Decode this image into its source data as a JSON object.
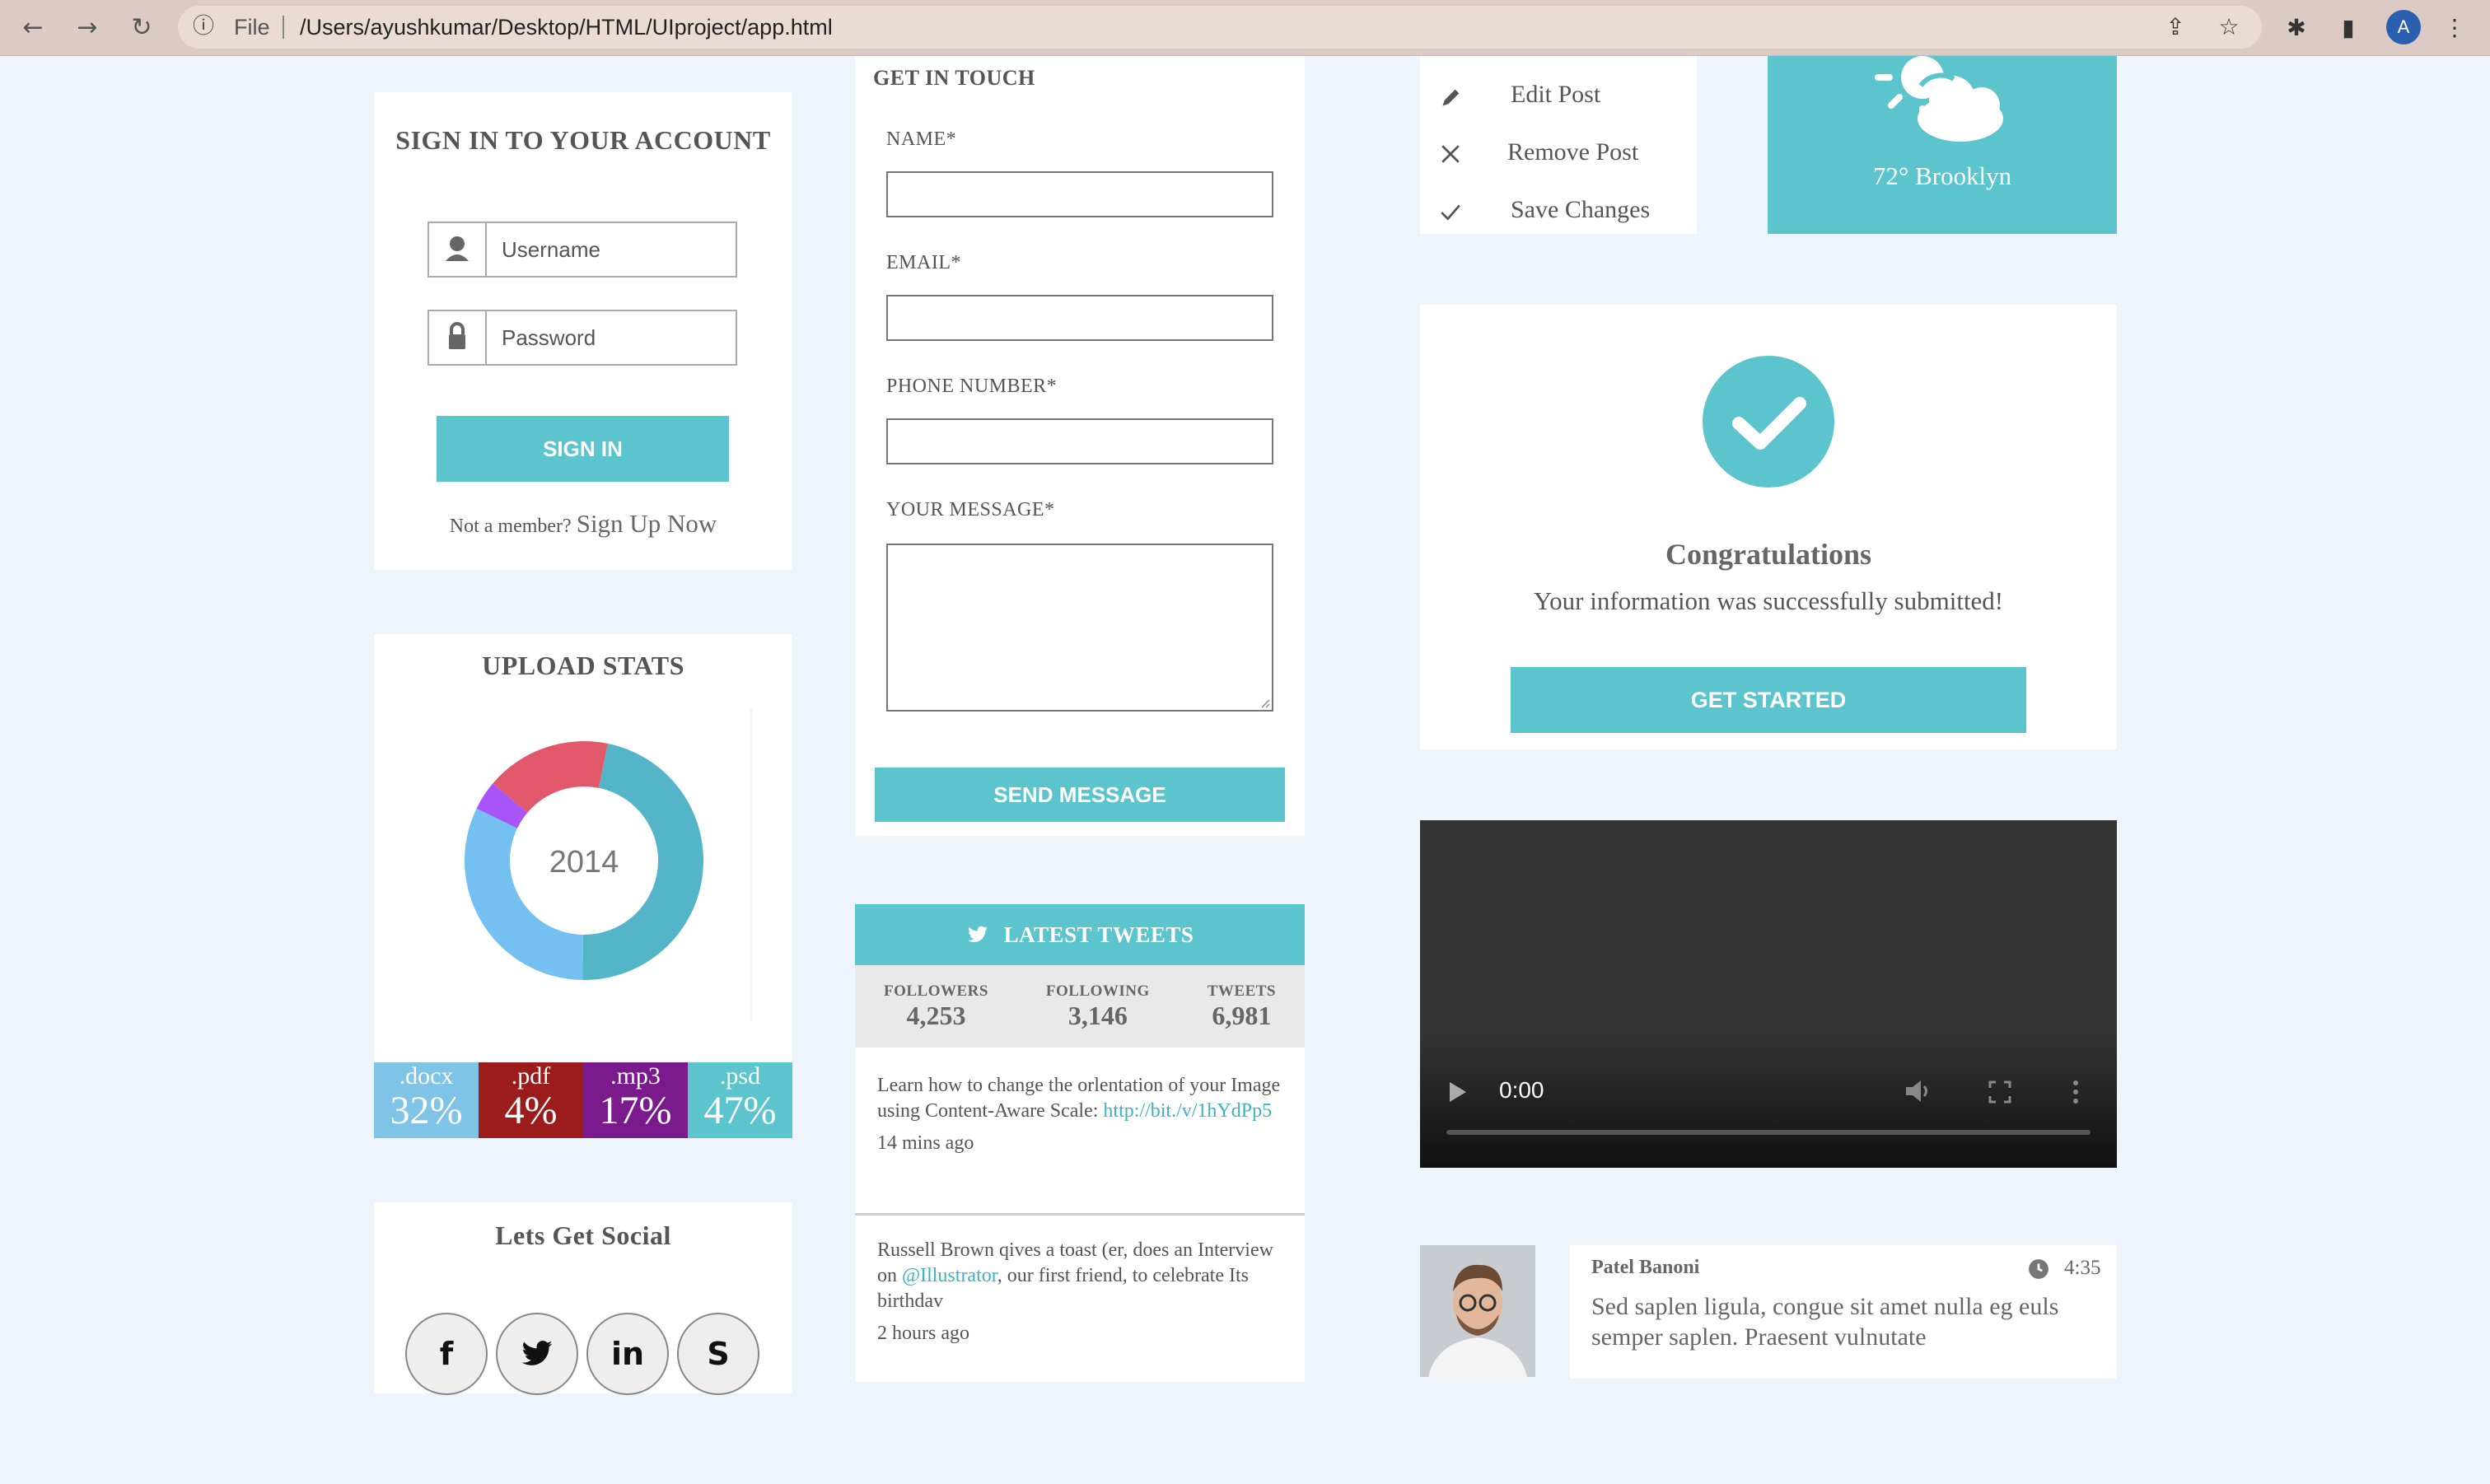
{
  "browser": {
    "scheme": "File",
    "url": "/Users/ayushkumar/Desktop/HTML/UIproject/app.html",
    "profile_initial": "A"
  },
  "colors": {
    "accent": "#5bc4cc",
    "page_bg": "#eef4fb"
  },
  "signin": {
    "title": "SIGN IN TO YOUR ACCOUNT",
    "username_placeholder": "Username",
    "password_placeholder": "Password",
    "button": "SIGN IN",
    "not_member": "Not a member?",
    "signup_link": "Sign Up Now"
  },
  "upload_stats": {
    "title": "UPLOAD STATS",
    "center_label": "2014",
    "items": [
      {
        "ext": ".docx",
        "pct": "32%",
        "value": 32,
        "bar_color": "#7fc3e6",
        "ring_color": "#74c0f0"
      },
      {
        "ext": ".pdf",
        "pct": "4%",
        "value": 4,
        "bar_color": "#9c1c1c",
        "ring_color": "#a855f7"
      },
      {
        "ext": ".mp3",
        "pct": "17%",
        "value": 17,
        "bar_color": "#7b1a8c",
        "ring_color": "#e0586a"
      },
      {
        "ext": ".psd",
        "pct": "47%",
        "value": 47,
        "bar_color": "#5bc4cc",
        "ring_color": "#55b5c8"
      }
    ]
  },
  "social": {
    "title": "Lets Get Social",
    "icons": [
      "facebook-icon",
      "twitter-icon",
      "linkedin-icon",
      "skype-icon"
    ],
    "glyphs": [
      "f",
      "🐦",
      "in",
      "S"
    ]
  },
  "contact": {
    "title": "GET IN TOUCH",
    "name_label": "NAME*",
    "email_label": "EMAIL*",
    "phone_label": "PHONE NUMBER*",
    "message_label": "YOUR MESSAGE*",
    "button": "SEND MESSAGE"
  },
  "tweets": {
    "header": "LATEST TWEETS",
    "stats": [
      {
        "label": "FOLLOWERS",
        "value": "4,253"
      },
      {
        "label": "FOLLOWING",
        "value": "3,146"
      },
      {
        "label": "TWEETS",
        "value": "6,981"
      }
    ],
    "items": [
      {
        "text": "Learn how to change the orlentation of your Image using Content-Aware Scale:",
        "link": "http://bit./v/1hYdPp5",
        "time": "14 mins ago"
      },
      {
        "text_before": "Russell Brown qives a toast (er, does an Interview on",
        "mention": "@Illustrator",
        "text_after": ", our first friend, to celebrate Its birthdav",
        "time": "2 hours ago"
      }
    ]
  },
  "post_menu": {
    "items": [
      {
        "label": "Edit Post",
        "icon": "pencil-icon"
      },
      {
        "label": "Remove Post",
        "icon": "x-icon"
      },
      {
        "label": "Save Changes",
        "icon": "check-icon"
      }
    ]
  },
  "weather": {
    "text": "72° Brooklyn",
    "icon": "partly-cloudy-icon"
  },
  "congrats": {
    "title": "Congratulations",
    "message": "Your information was successfully submitted!",
    "button": "GET STARTED"
  },
  "video": {
    "time": "0:00"
  },
  "comment": {
    "author": "Patel Banoni",
    "time": "4:35",
    "text": "Sed saplen ligula, congue sit amet nulla eg euls semper saplen. Praesent vulnutate"
  }
}
